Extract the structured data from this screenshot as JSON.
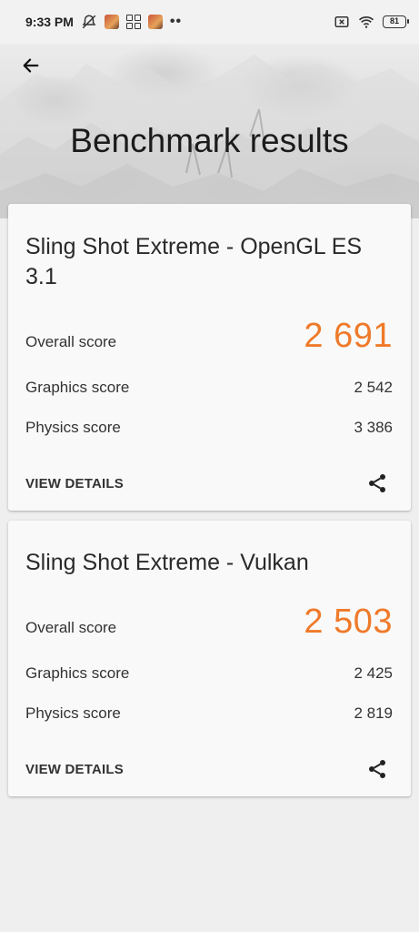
{
  "status_bar": {
    "time": "9:33 PM",
    "battery": "81"
  },
  "header": {
    "title": "Benchmark results"
  },
  "results": [
    {
      "title": "Sling Shot Extreme - OpenGL ES 3.1",
      "overall_label": "Overall score",
      "overall_value": "2 691",
      "graphics_label": "Graphics score",
      "graphics_value": "2 542",
      "physics_label": "Physics score",
      "physics_value": "3 386",
      "details_label": "VIEW DETAILS"
    },
    {
      "title": "Sling Shot Extreme - Vulkan",
      "overall_label": "Overall score",
      "overall_value": "2 503",
      "graphics_label": "Graphics score",
      "graphics_value": "2 425",
      "physics_label": "Physics score",
      "physics_value": "2 819",
      "details_label": "VIEW DETAILS"
    }
  ],
  "colors": {
    "accent_score": "#ef7a2a",
    "background": "#efefef",
    "card": "#f9f9f9"
  },
  "icons": {
    "back": "arrow-left-icon",
    "share": "share-icon"
  }
}
